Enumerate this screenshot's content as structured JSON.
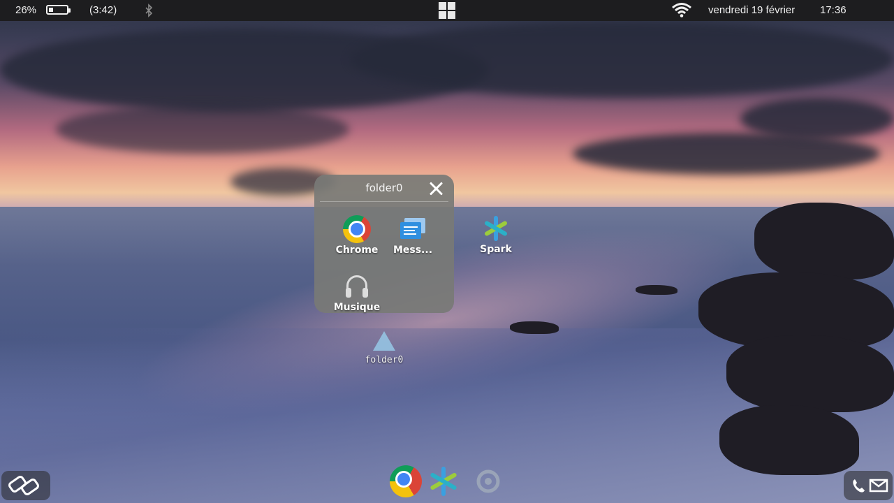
{
  "status_bar": {
    "battery_percent": "26%",
    "battery_level": 0.26,
    "battery_time": "(3:42)",
    "date": "vendredi 19 février",
    "time": "17:36"
  },
  "folder_popup": {
    "title": "folder0",
    "apps": [
      {
        "label": "Chrome",
        "icon": "chrome-icon"
      },
      {
        "label": "Mess...",
        "icon": "messages-icon"
      },
      {
        "label": "Musique",
        "icon": "headphones-icon"
      }
    ]
  },
  "desktop": {
    "spark_label": "Spark",
    "folder_label": "folder0"
  },
  "dock": {
    "icons": [
      "chrome-icon",
      "spark-icon",
      "settings-icon"
    ]
  },
  "colors": {
    "status_bar_bg": "#1d1d1f",
    "popup_bg": "#787a76",
    "spark_blue": "#3aa0e0",
    "spark_green": "#9ccc3c"
  }
}
